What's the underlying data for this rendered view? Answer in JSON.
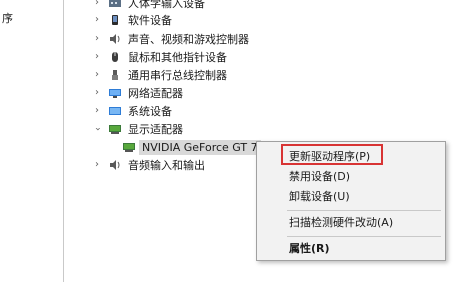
{
  "left_pane": {
    "text": "序"
  },
  "tree": {
    "items": [
      {
        "label": "人体学输入设备",
        "icon": "hid-icon",
        "expanded": false
      },
      {
        "label": "软件设备",
        "icon": "software-device-icon",
        "expanded": false
      },
      {
        "label": "声音、视频和游戏控制器",
        "icon": "speaker-icon",
        "expanded": false
      },
      {
        "label": "鼠标和其他指针设备",
        "icon": "mouse-icon",
        "expanded": false
      },
      {
        "label": "通用串行总线控制器",
        "icon": "usb-icon",
        "expanded": false
      },
      {
        "label": "网络适配器",
        "icon": "network-adapter-icon",
        "expanded": false
      },
      {
        "label": "系统设备",
        "icon": "system-device-icon",
        "expanded": false
      },
      {
        "label": "显示适配器",
        "icon": "display-adapter-icon",
        "expanded": true
      },
      {
        "label": "NVIDIA GeForce GT 7",
        "icon": "display-adapter-icon",
        "child": true,
        "selected": true
      },
      {
        "label": "音频输入和输出",
        "icon": "speaker-icon",
        "expanded": false
      }
    ]
  },
  "context_menu": {
    "items": [
      {
        "label": "更新驱动程序(P)"
      },
      {
        "label": "禁用设备(D)"
      },
      {
        "label": "卸载设备(U)"
      },
      {
        "label": "扫描检测硬件改动(A)"
      },
      {
        "label": "属性(R)"
      }
    ]
  },
  "colors": {
    "highlight_border": "#d83434",
    "selection": "#d9d9d9",
    "menu_background": "#f2f2f2"
  }
}
